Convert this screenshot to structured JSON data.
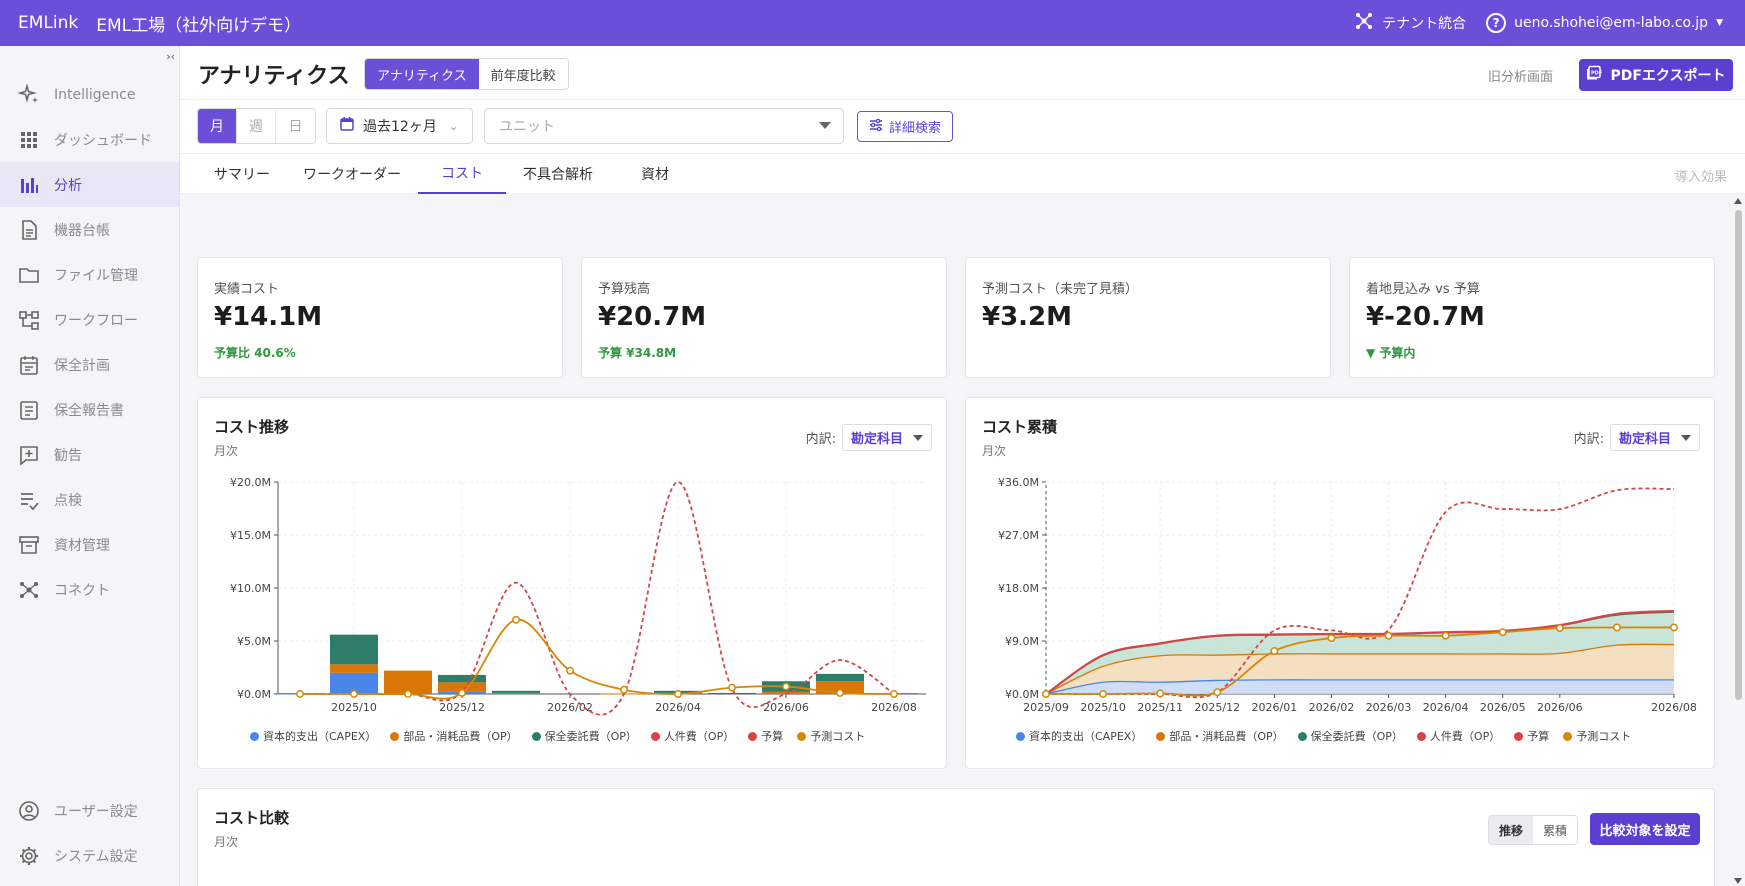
{
  "topbar": {
    "brand": "EMLink",
    "factory": "EML工場（社外向けデモ）",
    "tenant_label": "テナント統合",
    "user": "ueno.shohei@em-labo.co.jp"
  },
  "sidebar": {
    "collapse_label": "›‹",
    "items": [
      {
        "label": "Intelligence",
        "icon": "sparkle-icon"
      },
      {
        "label": "ダッシュボード",
        "icon": "grid-icon"
      },
      {
        "label": "分析",
        "icon": "bar-chart-icon",
        "active": true
      },
      {
        "label": "機器台帳",
        "icon": "document-icon"
      },
      {
        "label": "ファイル管理",
        "icon": "folder-icon"
      },
      {
        "label": "ワークフロー",
        "icon": "workflow-icon"
      },
      {
        "label": "保全計画",
        "icon": "calendar-icon"
      },
      {
        "label": "保全報告書",
        "icon": "report-icon"
      },
      {
        "label": "勧告",
        "icon": "advice-icon"
      },
      {
        "label": "点検",
        "icon": "checklist-icon"
      },
      {
        "label": "資材管理",
        "icon": "archive-icon"
      },
      {
        "label": "コネクト",
        "icon": "network-icon"
      }
    ],
    "bottom_items": [
      {
        "label": "ユーザー設定",
        "icon": "user-icon"
      },
      {
        "label": "システム設定",
        "icon": "gear-icon"
      }
    ]
  },
  "header": {
    "title": "アナリティクス",
    "view_tabs": [
      "アナリティクス",
      "前年度比較"
    ],
    "old_link": "旧分析画面",
    "pdf_button": "PDFエクスポート"
  },
  "filters": {
    "periods": [
      "月",
      "週",
      "日"
    ],
    "range": "過去12ヶ月",
    "unit_placeholder": "ユニット",
    "advanced": "詳細検索"
  },
  "tabs": {
    "items": [
      "サマリー",
      "ワークオーダー",
      "コスト",
      "不具合解析",
      "資材"
    ],
    "active": 2,
    "effect": "導入効果"
  },
  "kpis": [
    {
      "label": "実績コスト",
      "value": "¥14.1M",
      "sub": "予算比 40.6%"
    },
    {
      "label": "予算残高",
      "value": "¥20.7M",
      "sub": "予算 ¥34.8M"
    },
    {
      "label": "予測コスト（未完了見積）",
      "value": "¥3.2M",
      "sub": ""
    },
    {
      "label": "着地見込み vs 予算",
      "value": "¥-20.7M",
      "sub": "▼ 予算内"
    }
  ],
  "charts": {
    "trend": {
      "title": "コスト推移",
      "subtitle": "月次",
      "breakdown_label": "内訳:",
      "breakdown_value": "勘定科目"
    },
    "cumulative": {
      "title": "コスト累積",
      "subtitle": "月次",
      "breakdown_label": "内訳:",
      "breakdown_value": "勘定科目"
    },
    "compare": {
      "title": "コスト比較",
      "subtitle": "月次",
      "modes": [
        "推移",
        "累積"
      ],
      "set_button": "比較対象を設定"
    }
  },
  "colors": {
    "accent": "#6c4fd9",
    "capex": "#4a86e8",
    "parts": "#d97706",
    "outsourcing": "#2e7d6b",
    "labor": "#d64545",
    "budget": "#d64545",
    "forecast": "#d48806"
  },
  "chart_data": [
    {
      "type": "bar",
      "title": "コスト推移",
      "subtitle": "月次",
      "categories": [
        "2025/09",
        "2025/10",
        "2025/11",
        "2025/12",
        "2026/01",
        "2026/02",
        "2026/03",
        "2026/04",
        "2026/05",
        "2026/06",
        "2026/07",
        "2026/08"
      ],
      "x_tick_labels": [
        "2025/10",
        "2025/12",
        "2026/02",
        "2026/04",
        "2026/06",
        "2026/08"
      ],
      "y_tick_labels": [
        "¥0.0M",
        "¥5.0M",
        "¥10.0M",
        "¥15.0M",
        "¥20.0M"
      ],
      "ylim": [
        0,
        20
      ],
      "series": [
        {
          "name": "資本的支出（CAPEX）",
          "values": [
            0.05,
            2.0,
            0,
            0.2,
            0,
            0,
            0,
            0,
            0,
            0,
            0,
            0
          ]
        },
        {
          "name": "部品・消耗品費（OP）",
          "values": [
            0.05,
            0.8,
            2.2,
            0.9,
            0.1,
            0,
            0.05,
            0.1,
            0,
            0.2,
            1.2,
            0.1
          ]
        },
        {
          "name": "保全委託費（OP）",
          "values": [
            0,
            2.8,
            0,
            0.7,
            0.2,
            0,
            0,
            0.2,
            0.1,
            1.0,
            0.7,
            0
          ]
        },
        {
          "name": "人件費（OP）",
          "values": [
            0,
            0,
            0,
            0,
            0,
            0,
            0,
            0,
            0,
            0,
            0,
            0
          ]
        },
        {
          "name": "予算",
          "values": [
            0,
            0,
            0,
            0.2,
            10.5,
            0,
            0,
            20.0,
            0.5,
            0,
            3.2,
            0
          ]
        },
        {
          "name": "予測コスト",
          "values": [
            0,
            0,
            0,
            0.1,
            7.0,
            2.2,
            0.4,
            0,
            0.6,
            0.7,
            0.1,
            0
          ]
        }
      ]
    },
    {
      "type": "area",
      "title": "コスト累積",
      "subtitle": "月次",
      "categories": [
        "2025/09",
        "2025/10",
        "2025/11",
        "2025/12",
        "2026/01",
        "2026/02",
        "2026/03",
        "2026/04",
        "2026/05",
        "2026/06",
        "2026/07",
        "2026/08"
      ],
      "x_tick_labels": [
        "2025/09",
        "2025/10",
        "2025/11",
        "2025/12",
        "2026/01",
        "2026/02",
        "2026/03",
        "2026/04",
        "2026/05",
        "2026/06",
        "2026/08"
      ],
      "y_tick_labels": [
        "¥0.0M",
        "¥9.0M",
        "¥18.0M",
        "¥27.0M",
        "¥36.0M"
      ],
      "ylim": [
        0,
        36
      ],
      "series": [
        {
          "name": "資本的支出（CAPEX）",
          "values": [
            0,
            2.0,
            2.0,
            2.3,
            2.4,
            2.4,
            2.4,
            2.4,
            2.4,
            2.4,
            2.4,
            2.4
          ]
        },
        {
          "name": "部品・消耗品費（OP）",
          "values": [
            0,
            4.7,
            6.5,
            6.6,
            6.8,
            6.8,
            6.8,
            6.8,
            6.8,
            6.9,
            8.3,
            8.4
          ]
        },
        {
          "name": "保全委託費（OP）",
          "values": [
            0,
            6.5,
            8.5,
            9.8,
            10.0,
            10.1,
            10.1,
            10.4,
            10.6,
            11.6,
            13.4,
            13.9
          ]
        },
        {
          "name": "人件費（OP）",
          "values": [
            0,
            6.6,
            8.6,
            9.9,
            10.1,
            10.2,
            10.2,
            10.5,
            10.7,
            11.7,
            13.6,
            14.1
          ]
        },
        {
          "name": "予算",
          "values": [
            0,
            0,
            0,
            0.3,
            10.8,
            10.8,
            10.9,
            30.9,
            31.4,
            31.4,
            34.6,
            34.8
          ]
        },
        {
          "name": "予測コスト",
          "values": [
            0,
            0,
            0.1,
            0.3,
            7.3,
            9.5,
            9.9,
            9.9,
            10.5,
            11.2,
            11.3,
            11.3
          ]
        }
      ]
    }
  ]
}
